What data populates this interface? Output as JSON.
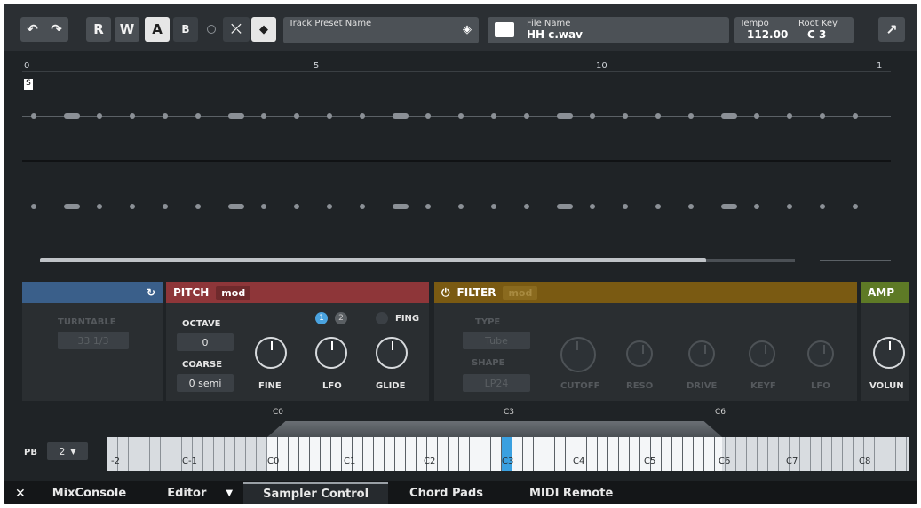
{
  "toolbar": {
    "buttons": [
      "R",
      "W",
      "A",
      "B"
    ],
    "track_preset_label": "Track Preset Name",
    "file_name_caption": "File Name",
    "file_name": "HH c.wav",
    "tempo_caption": "Tempo",
    "tempo_value": "112.00",
    "root_key_caption": "Root Key",
    "root_key_value": "C 3"
  },
  "ruler": {
    "ticks": [
      "0",
      "5",
      "10",
      "1"
    ]
  },
  "modules": {
    "pitch": {
      "title": "PITCH",
      "tag": "mod",
      "octave_label": "OCTAVE",
      "octave_value": "0",
      "coarse_label": "COARSE",
      "coarse_value": "0 semi",
      "fine_label": "FINE",
      "lfo_label": "LFO",
      "glide_label": "GLIDE",
      "fing_label": "FING",
      "lfo1": "1",
      "lfo2": "2"
    },
    "turntable": {
      "label": "TURNTABLE",
      "value": "33 1/3"
    },
    "filter": {
      "title": "FILTER",
      "tag": "mod",
      "type_label": "TYPE",
      "type_value": "Tube",
      "shape_label": "SHAPE",
      "shape_value": "LP24",
      "cutoff_label": "CUTOFF",
      "reso_label": "RESO",
      "drive_label": "DRIVE",
      "keyf_label": "KEYF",
      "lfo_label": "LFO"
    },
    "amp": {
      "title": "AMP",
      "volume_label": "VOLUN"
    }
  },
  "keyboard": {
    "pb_label": "PB",
    "pb_value": "2",
    "markers": [
      "C0",
      "C3",
      "C6"
    ],
    "octaves": [
      "-2",
      "C-1",
      "C0",
      "C1",
      "C2",
      "C3",
      "C4",
      "C5",
      "C6",
      "C7",
      "C8"
    ]
  },
  "tabs": [
    "MixConsole",
    "Editor",
    "Sampler Control",
    "Chord Pads",
    "MIDI Remote"
  ]
}
